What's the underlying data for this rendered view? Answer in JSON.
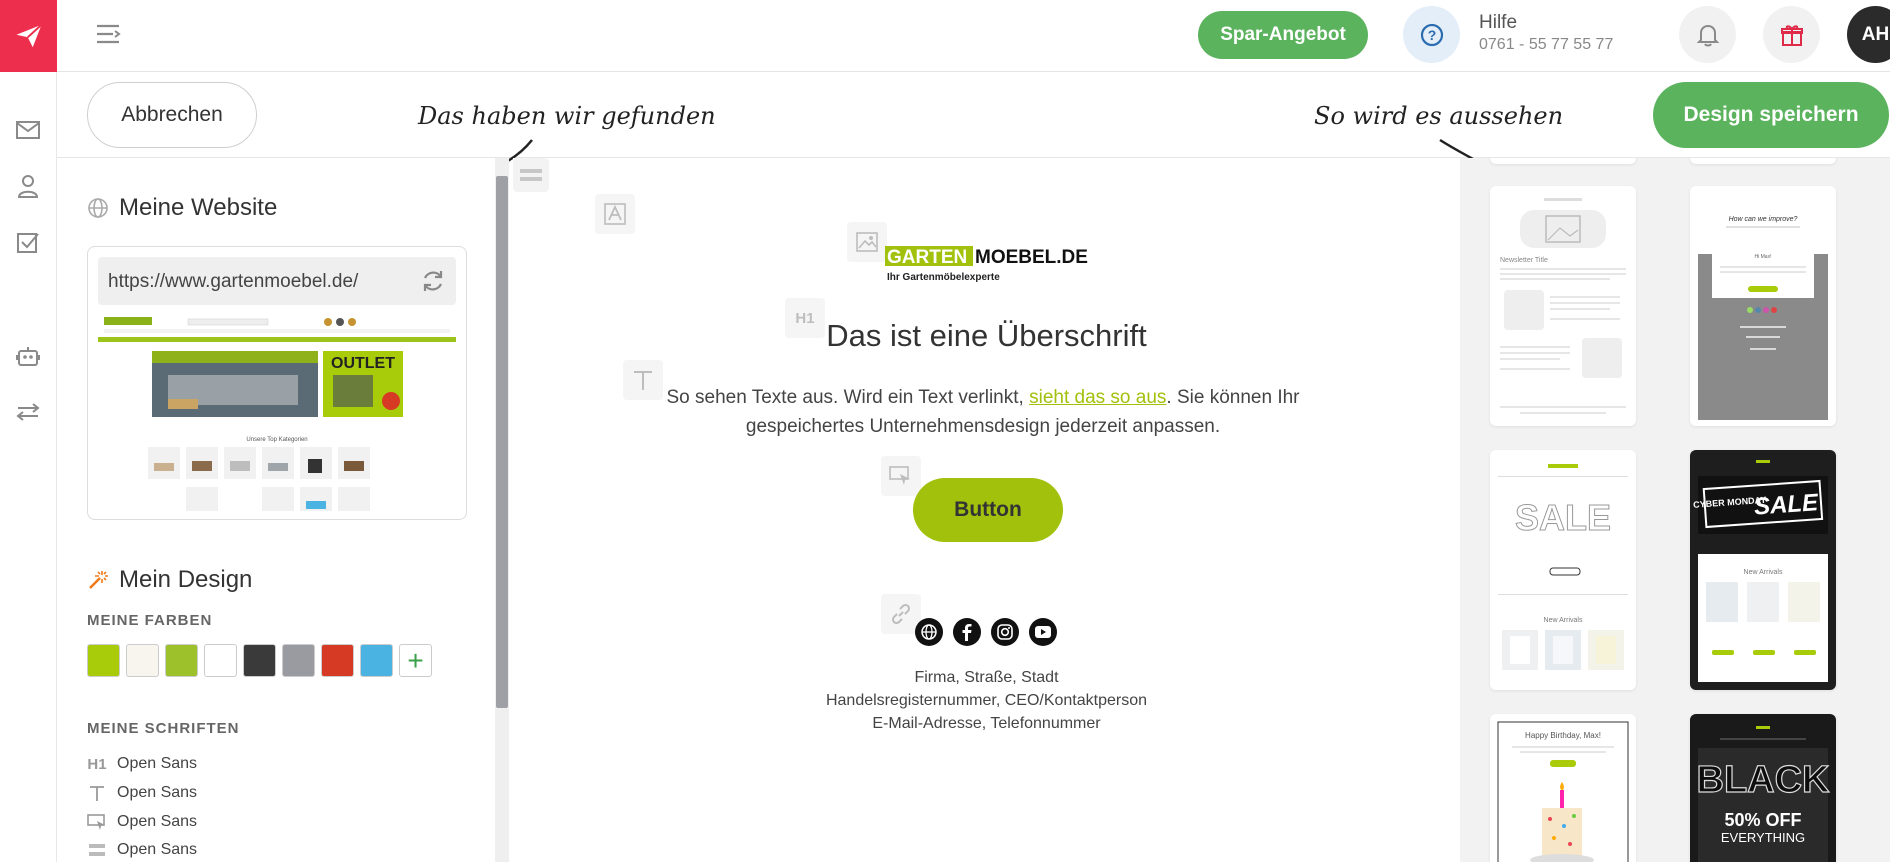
{
  "topbar": {
    "spar_label": "Spar-Angebot",
    "help_title": "Hilfe",
    "help_phone": "0761 - 55 77 55 77",
    "avatar_initials": "AH"
  },
  "actions": {
    "cancel_label": "Abbrechen",
    "save_label": "Design speichern"
  },
  "annotations": {
    "found": "Das haben wir gefunden",
    "looks": "So wird es aussehen"
  },
  "left": {
    "website_title": "Meine Website",
    "url": "https://www.gartenmoebel.de/",
    "design_title": "Mein Design",
    "colors_caption": "MEINE FARBEN",
    "fonts_caption": "MEINE SCHRIFTEN",
    "colors": [
      "#a8cc0a",
      "#f7f5ee",
      "#9dc12a",
      "#ffffff",
      "#3a3a3a",
      "#999ba1",
      "#d63a24",
      "#4ab3e2"
    ],
    "fonts": [
      {
        "icon": "heading-icon",
        "name": "Open Sans"
      },
      {
        "icon": "text-icon",
        "name": "Open Sans"
      },
      {
        "icon": "cursor-icon",
        "name": "Open Sans"
      },
      {
        "icon": "block-icon",
        "name": "Open Sans"
      }
    ]
  },
  "thumb": {
    "outlet": "OUTLET",
    "lower_title": "Unsere Top Kategorien"
  },
  "preview": {
    "logo_a": "GARTEN",
    "logo_b": "MOEBEL.DE",
    "logo_tagline": "Ihr Gartenmöbelexperte",
    "h1_badge": "H1",
    "heading": "Das ist eine Überschrift",
    "text_before": "So sehen Texte aus. Wird ein Text verlinkt, ",
    "text_link": "sieht das so aus",
    "text_after": ". Sie können Ihr gespeichertes Unternehmensdesign jederzeit anpassen.",
    "button": "Button",
    "footer_1": "Firma, Straße, Stadt",
    "footer_2": "Handelsregisternummer, CEO/Kontaktperson",
    "footer_3": "E-Mail-Adresse, Telefonnummer"
  },
  "templates": {
    "t1_title": "Newsletter Title",
    "t2_title": "How can we improve?",
    "t2_sub": "Hi Max!",
    "t3_sale": "SALE",
    "t3_arrivals": "New Arrivals",
    "t4_cyber": "CYBER MONDAY",
    "t4_sale": "SALE",
    "t4_arrivals": "New Arrivals",
    "t5_title": "Happy Birthday, Max!",
    "t6_black": "BLACK",
    "t6_off": "50% OFF",
    "t6_every": "EVERYTHING"
  }
}
